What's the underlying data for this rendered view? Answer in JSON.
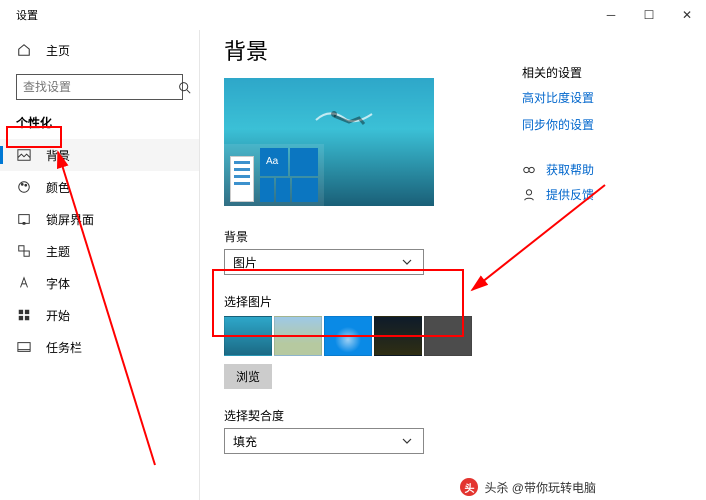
{
  "window": {
    "title": "设置"
  },
  "sidebar": {
    "home": "主页",
    "search_placeholder": "查找设置",
    "section": "个性化",
    "items": [
      {
        "label": "背景"
      },
      {
        "label": "颜色"
      },
      {
        "label": "锁屏界面"
      },
      {
        "label": "主题"
      },
      {
        "label": "字体"
      },
      {
        "label": "开始"
      },
      {
        "label": "任务栏"
      }
    ]
  },
  "main": {
    "title": "背景",
    "bg_label": "背景",
    "bg_value": "图片",
    "choose_label": "选择图片",
    "browse": "浏览",
    "fit_label": "选择契合度",
    "fit_value": "填充"
  },
  "right": {
    "related": "相关的设置",
    "hc": "高对比度设置",
    "sync": "同步你的设置",
    "help": "获取帮助",
    "feedback": "提供反馈"
  },
  "watermark": "头杀 @带你玩转电脑"
}
